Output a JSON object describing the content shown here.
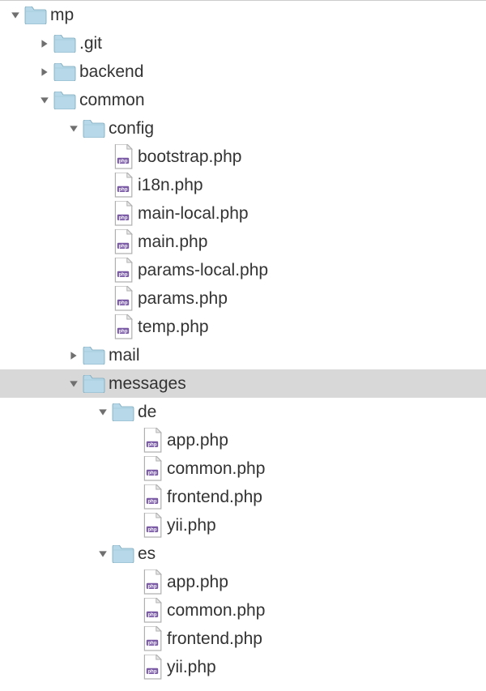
{
  "tree": {
    "name": "mp",
    "type": "folder",
    "expanded": true,
    "selected": false,
    "children": [
      {
        "name": ".git",
        "type": "folder",
        "expanded": false,
        "selected": false
      },
      {
        "name": "backend",
        "type": "folder",
        "expanded": false,
        "selected": false
      },
      {
        "name": "common",
        "type": "folder",
        "expanded": true,
        "selected": false,
        "children": [
          {
            "name": "config",
            "type": "folder",
            "expanded": true,
            "selected": false,
            "children": [
              {
                "name": "bootstrap.php",
                "type": "php",
                "selected": false
              },
              {
                "name": "i18n.php",
                "type": "php",
                "selected": false
              },
              {
                "name": "main-local.php",
                "type": "php",
                "selected": false
              },
              {
                "name": "main.php",
                "type": "php",
                "selected": false
              },
              {
                "name": "params-local.php",
                "type": "php",
                "selected": false
              },
              {
                "name": "params.php",
                "type": "php",
                "selected": false
              },
              {
                "name": "temp.php",
                "type": "php",
                "selected": false
              }
            ]
          },
          {
            "name": "mail",
            "type": "folder",
            "expanded": false,
            "selected": false
          },
          {
            "name": "messages",
            "type": "folder",
            "expanded": true,
            "selected": true,
            "children": [
              {
                "name": "de",
                "type": "folder",
                "expanded": true,
                "selected": false,
                "children": [
                  {
                    "name": "app.php",
                    "type": "php",
                    "selected": false
                  },
                  {
                    "name": "common.php",
                    "type": "php",
                    "selected": false
                  },
                  {
                    "name": "frontend.php",
                    "type": "php",
                    "selected": false
                  },
                  {
                    "name": "yii.php",
                    "type": "php",
                    "selected": false
                  }
                ]
              },
              {
                "name": "es",
                "type": "folder",
                "expanded": true,
                "selected": false,
                "children": [
                  {
                    "name": "app.php",
                    "type": "php",
                    "selected": false
                  },
                  {
                    "name": "common.php",
                    "type": "php",
                    "selected": false
                  },
                  {
                    "name": "frontend.php",
                    "type": "php",
                    "selected": false
                  },
                  {
                    "name": "yii.php",
                    "type": "php",
                    "selected": false
                  }
                ]
              }
            ]
          }
        ]
      }
    ]
  },
  "indentUnit": 36,
  "baseIndent": 10
}
